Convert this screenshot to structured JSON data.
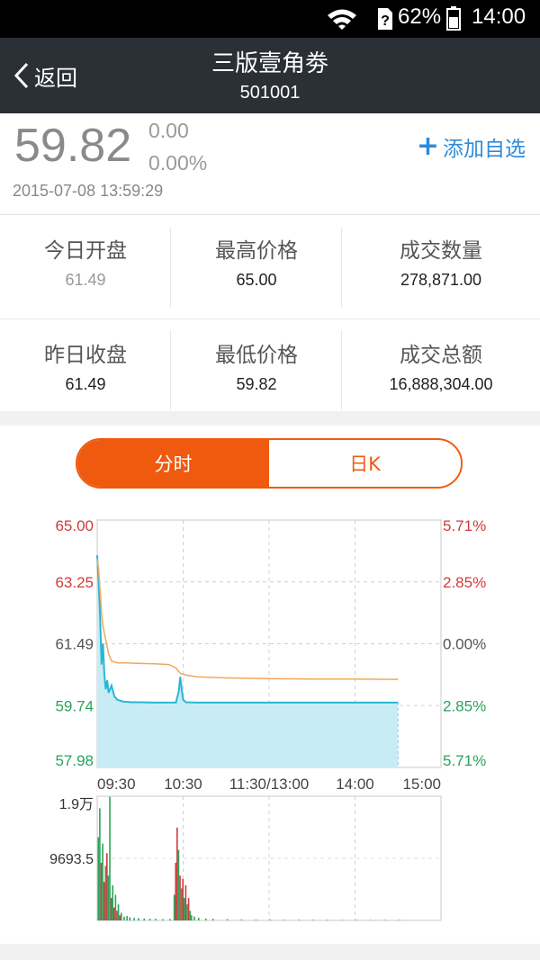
{
  "status_bar": {
    "battery": "62%",
    "time": "14:00"
  },
  "nav": {
    "back_label": "返回",
    "title": "三版壹角劵",
    "code": "501001"
  },
  "quote": {
    "price": "59.82",
    "change": "0.00",
    "change_pct": "0.00%",
    "timestamp": "2015-07-08 13:59:29",
    "add_watch_label": "添加自选"
  },
  "stats": [
    {
      "label": "今日开盘",
      "value": "61.49"
    },
    {
      "label": "最高价格",
      "value": "65.00"
    },
    {
      "label": "成交数量",
      "value": "278,871.00"
    },
    {
      "label": "昨日收盘",
      "value": "61.49"
    },
    {
      "label": "最低价格",
      "value": "59.82"
    },
    {
      "label": "成交总额",
      "value": "16,888,304.00"
    }
  ],
  "tabs": {
    "intraday": "分时",
    "daily_k": "日K"
  },
  "colors": {
    "up": "#d03b3b",
    "down": "#2aa35a",
    "neutral": "#555555",
    "accent": "#f05a0f",
    "price_line": "#29b6d6",
    "avg_line": "#f0a85c"
  },
  "chart_data": [
    {
      "type": "area",
      "y_left_ticks": [
        "65.00",
        "63.25",
        "61.49",
        "59.74",
        "57.98"
      ],
      "y_right_ticks": [
        "5.71%",
        "2.85%",
        "0.00%",
        "2.85%",
        "5.71%"
      ],
      "x_ticks": [
        "09:30",
        "10:30",
        "11:30/13:00",
        "14:00",
        "15:00"
      ],
      "ylim": [
        57.98,
        65.0
      ],
      "x_range_minutes": [
        0,
        240
      ],
      "grid": true,
      "series": [
        {
          "values": [
            [
              0,
              64.0
            ],
            [
              1,
              63.2
            ],
            [
              2,
              62.3
            ],
            [
              3,
              60.9
            ],
            [
              4,
              61.5
            ],
            [
              5,
              60.6
            ],
            [
              6,
              60.2
            ],
            [
              7,
              60.45
            ],
            [
              8,
              60.1
            ],
            [
              10,
              60.3
            ],
            [
              12,
              60.0
            ],
            [
              14,
              59.9
            ],
            [
              18,
              59.85
            ],
            [
              24,
              59.83
            ],
            [
              30,
              59.83
            ],
            [
              40,
              59.82
            ],
            [
              50,
              59.82
            ],
            [
              55,
              59.82
            ],
            [
              57,
              60.15
            ],
            [
              58,
              60.55
            ],
            [
              59,
              60.2
            ],
            [
              60,
              59.9
            ],
            [
              62,
              59.83
            ],
            [
              70,
              59.82
            ],
            [
              90,
              59.82
            ],
            [
              120,
              59.82
            ],
            [
              150,
              59.82
            ],
            [
              180,
              59.82
            ],
            [
              210,
              59.82
            ]
          ]
        },
        {
          "values": [
            [
              0,
              63.9
            ],
            [
              1,
              63.6
            ],
            [
              2,
              63.0
            ],
            [
              3,
              62.4
            ],
            [
              4,
              62.0
            ],
            [
              6,
              61.6
            ],
            [
              8,
              61.2
            ],
            [
              10,
              61.0
            ],
            [
              14,
              60.95
            ],
            [
              20,
              60.95
            ],
            [
              30,
              60.93
            ],
            [
              40,
              60.92
            ],
            [
              50,
              60.9
            ],
            [
              55,
              60.8
            ],
            [
              58,
              60.65
            ],
            [
              62,
              60.6
            ],
            [
              70,
              60.55
            ],
            [
              90,
              60.52
            ],
            [
              120,
              60.5
            ],
            [
              150,
              60.49
            ],
            [
              180,
              60.49
            ],
            [
              210,
              60.48
            ]
          ]
        }
      ]
    },
    {
      "type": "bar",
      "y_ticks": [
        "1.9万",
        "9693.5"
      ],
      "ylim": [
        0,
        19387
      ],
      "bars": [
        [
          0,
          13000,
          "down"
        ],
        [
          1,
          17500,
          "down"
        ],
        [
          2,
          9000,
          "up"
        ],
        [
          3,
          12000,
          "down"
        ],
        [
          4,
          6000,
          "up"
        ],
        [
          5,
          8500,
          "down"
        ],
        [
          6,
          10500,
          "up"
        ],
        [
          7,
          7000,
          "down"
        ],
        [
          8,
          19300,
          "down"
        ],
        [
          9,
          3500,
          "up"
        ],
        [
          10,
          5500,
          "down"
        ],
        [
          11,
          2000,
          "up"
        ],
        [
          12,
          4000,
          "down"
        ],
        [
          13,
          1500,
          "up"
        ],
        [
          14,
          2500,
          "down"
        ],
        [
          15,
          800,
          "up"
        ],
        [
          16,
          1200,
          "down"
        ],
        [
          18,
          600,
          "down"
        ],
        [
          20,
          700,
          "down"
        ],
        [
          22,
          500,
          "down"
        ],
        [
          25,
          400,
          "down"
        ],
        [
          28,
          350,
          "down"
        ],
        [
          32,
          300,
          "down"
        ],
        [
          36,
          250,
          "down"
        ],
        [
          40,
          250,
          "down"
        ],
        [
          45,
          200,
          "down"
        ],
        [
          50,
          220,
          "down"
        ],
        [
          53,
          4000,
          "down"
        ],
        [
          54,
          9000,
          "up"
        ],
        [
          55,
          14500,
          "up"
        ],
        [
          56,
          11000,
          "down"
        ],
        [
          57,
          7000,
          "up"
        ],
        [
          58,
          5000,
          "down"
        ],
        [
          59,
          6500,
          "up"
        ],
        [
          60,
          3500,
          "down"
        ],
        [
          61,
          5500,
          "up"
        ],
        [
          62,
          2500,
          "down"
        ],
        [
          63,
          3500,
          "up"
        ],
        [
          64,
          1500,
          "down"
        ],
        [
          65,
          800,
          "down"
        ],
        [
          67,
          600,
          "down"
        ],
        [
          70,
          400,
          "down"
        ],
        [
          75,
          300,
          "down"
        ],
        [
          80,
          250,
          "down"
        ],
        [
          90,
          200,
          "down"
        ],
        [
          100,
          150,
          "down"
        ],
        [
          110,
          120,
          "down"
        ],
        [
          120,
          120,
          "down"
        ],
        [
          130,
          100,
          "down"
        ],
        [
          140,
          100,
          "down"
        ],
        [
          150,
          100,
          "down"
        ],
        [
          160,
          100,
          "down"
        ],
        [
          170,
          80,
          "down"
        ],
        [
          180,
          80,
          "down"
        ],
        [
          190,
          80,
          "down"
        ],
        [
          200,
          80,
          "down"
        ],
        [
          210,
          80,
          "down"
        ]
      ]
    }
  ]
}
